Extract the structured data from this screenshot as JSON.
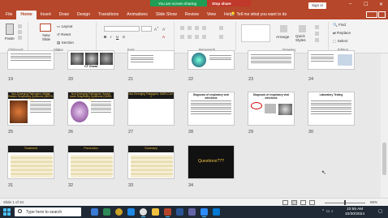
{
  "ribbon_tabs": [
    "File",
    "Home",
    "Insert",
    "Draw",
    "Design",
    "Transitions",
    "Animations",
    "Slide Show",
    "Review",
    "View",
    "Help"
  ],
  "active_tab": "Home",
  "tell_me": "Tell me what you want to do",
  "share_banner": {
    "status": "You are screen sharing",
    "stop": "Stop share"
  },
  "sign_in": "Sign in",
  "ribbon": {
    "paste": "Paste",
    "new_slide": "New Slide",
    "layout": "Layout",
    "reset": "Reset",
    "section": "Section",
    "arrange": "Arrange",
    "quick_styles": "Quick Styles",
    "find": "Find",
    "replace": "Replace",
    "select": "Select",
    "groups": [
      "Clipboard",
      "Slides",
      "Font",
      "Paragraph",
      "Drawing",
      "Editing"
    ]
  },
  "slides": [
    {
      "num": "19",
      "title": ""
    },
    {
      "num": "20",
      "title": "CT Chest"
    },
    {
      "num": "21",
      "title": ""
    },
    {
      "num": "22",
      "title": ""
    },
    {
      "num": "23",
      "title": ""
    },
    {
      "num": "24",
      "title": ""
    },
    {
      "num": "25",
      "title": "Non-Emerging Pathogens: Middle Eastern Respiratory Syndrome (MERS-CoV)"
    },
    {
      "num": "26",
      "title": "Non-Emerging Pathogens: Severe Acute Respiratory Syndrome (SARS-CoV)"
    },
    {
      "num": "27",
      "title": "Non-Emerging Pathogens: SARS-CoV-2"
    },
    {
      "num": "28",
      "title": "Diagnosis of respiratory viral infections"
    },
    {
      "num": "29",
      "title": "Diagnosis of respiratory viral infections"
    },
    {
      "num": "30",
      "title": "Laboratory Testing"
    },
    {
      "num": "31",
      "title": "Treatment"
    },
    {
      "num": "32",
      "title": "Prevention"
    },
    {
      "num": "33",
      "title": "Summary"
    },
    {
      "num": "34",
      "title": "Questions???"
    }
  ],
  "status": {
    "slide_info": "Slide 1 of 34",
    "zoom": "66%"
  },
  "taskbar": {
    "search": "Type here to search",
    "time": "10:55 AM",
    "date": "10/30/2024"
  },
  "colors": {
    "brand": "#b7472a",
    "share_green": "#1f9d55",
    "share_red": "#c0392b",
    "taskbar": "#1f2a36"
  }
}
